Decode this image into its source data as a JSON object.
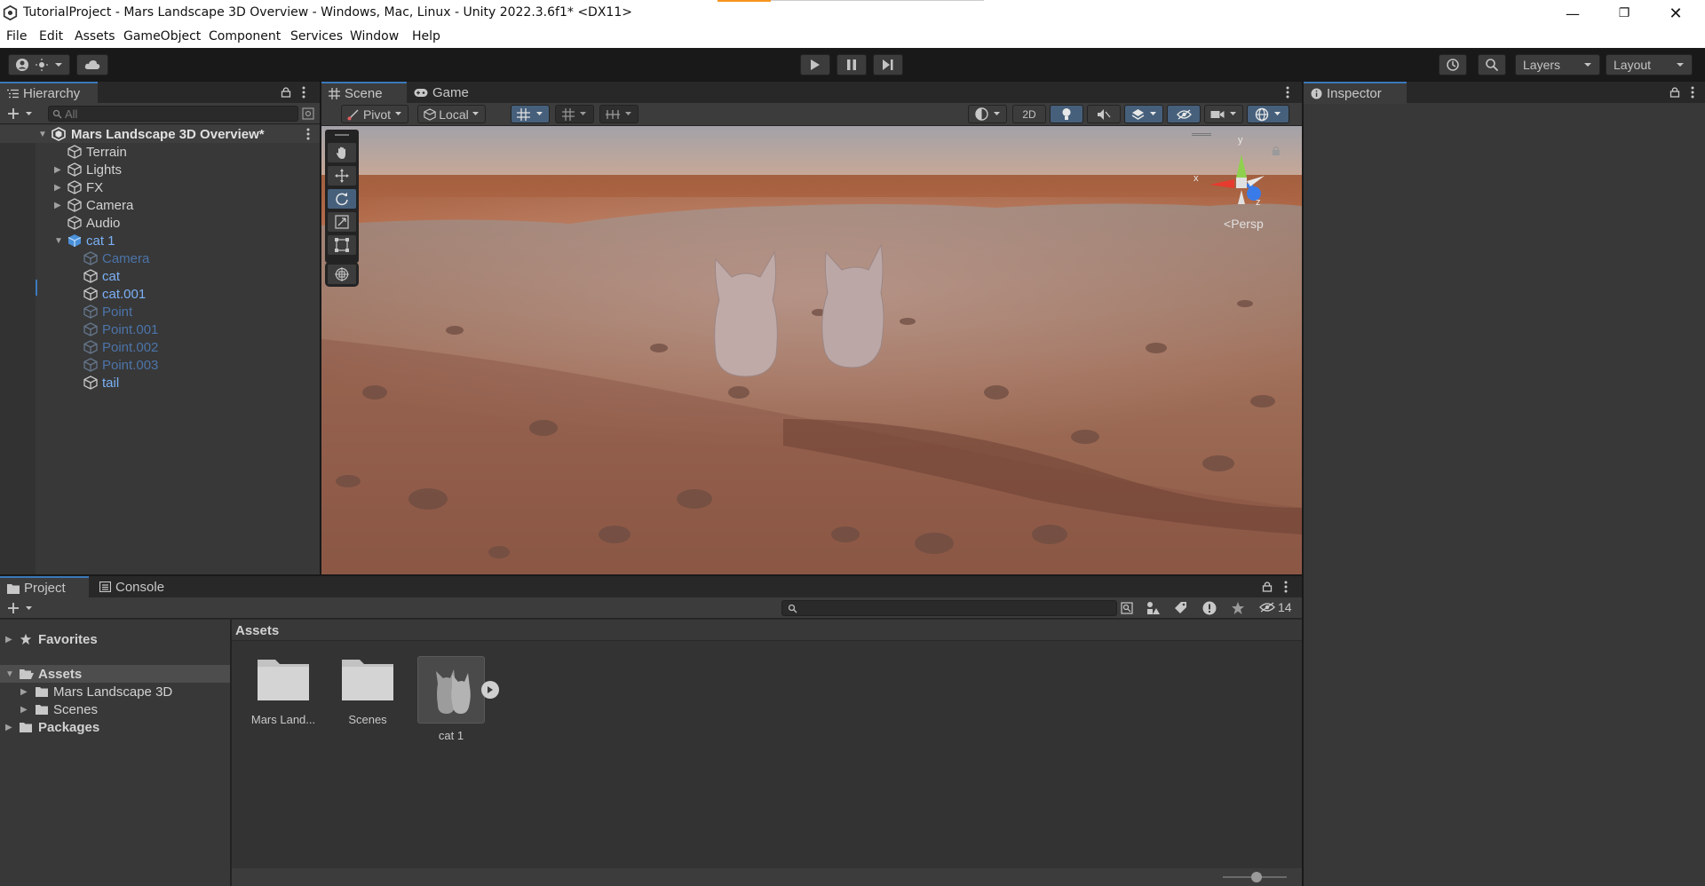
{
  "window": {
    "title": "TutorialProject - Mars Landscape 3D Overview - Windows, Mac, Linux - Unity 2022.3.6f1* <DX11>",
    "minimize_icon": "minimize-icon",
    "maximize_icon": "restore-icon",
    "close_icon": "close-icon"
  },
  "menu": [
    "File",
    "Edit",
    "Assets",
    "GameObject",
    "Component",
    "Services",
    "Window",
    "Help"
  ],
  "toolbar": {
    "layers_label": "Layers",
    "layout_label": "Layout"
  },
  "hierarchy": {
    "tab_label": "Hierarchy",
    "search_placeholder": "All",
    "scene_name": "Mars Landscape 3D Overview*",
    "items": [
      {
        "label": "Terrain",
        "style": "normal",
        "expandable": false
      },
      {
        "label": "Lights",
        "style": "normal",
        "expandable": true
      },
      {
        "label": "FX",
        "style": "normal",
        "expandable": true
      },
      {
        "label": "Camera",
        "style": "normal",
        "expandable": true
      },
      {
        "label": "Audio",
        "style": "normal",
        "expandable": false
      },
      {
        "label": "cat 1",
        "style": "prefab",
        "expandable": true,
        "expanded": true
      },
      {
        "label": "Camera",
        "style": "faded",
        "child": true
      },
      {
        "label": "cat",
        "style": "blue",
        "child": true
      },
      {
        "label": "cat.001",
        "style": "blue",
        "child": true
      },
      {
        "label": "Point",
        "style": "faded",
        "child": true
      },
      {
        "label": "Point.001",
        "style": "faded",
        "child": true
      },
      {
        "label": "Point.002",
        "style": "faded",
        "child": true
      },
      {
        "label": "Point.003",
        "style": "faded",
        "child": true
      },
      {
        "label": "tail",
        "style": "blue",
        "child": true
      }
    ]
  },
  "scene": {
    "tab_scene": "Scene",
    "tab_game": "Game",
    "pivot_label": "Pivot",
    "local_label": "Local",
    "twod_label": "2D",
    "gizmo_persp": "Persp",
    "axis_x": "x",
    "axis_y": "y",
    "axis_z": "z"
  },
  "inspector": {
    "tab_label": "Inspector"
  },
  "project": {
    "tab_project": "Project",
    "tab_console": "Console",
    "favorites_label": "Favorites",
    "assets_label": "Assets",
    "packages_label": "Packages",
    "tree": [
      "Mars Landscape 3D",
      "Scenes"
    ],
    "breadcrumb": "Assets",
    "hidden_count": "14",
    "assets": [
      {
        "label": "Mars Land...",
        "type": "folder"
      },
      {
        "label": "Scenes",
        "type": "folder"
      },
      {
        "label": "cat 1",
        "type": "prefab"
      }
    ]
  },
  "colors": {
    "accent": "#3a79bb",
    "selected_blue": "#7bb0f6",
    "panel_bg": "#383838",
    "dark_bg": "#191919"
  }
}
